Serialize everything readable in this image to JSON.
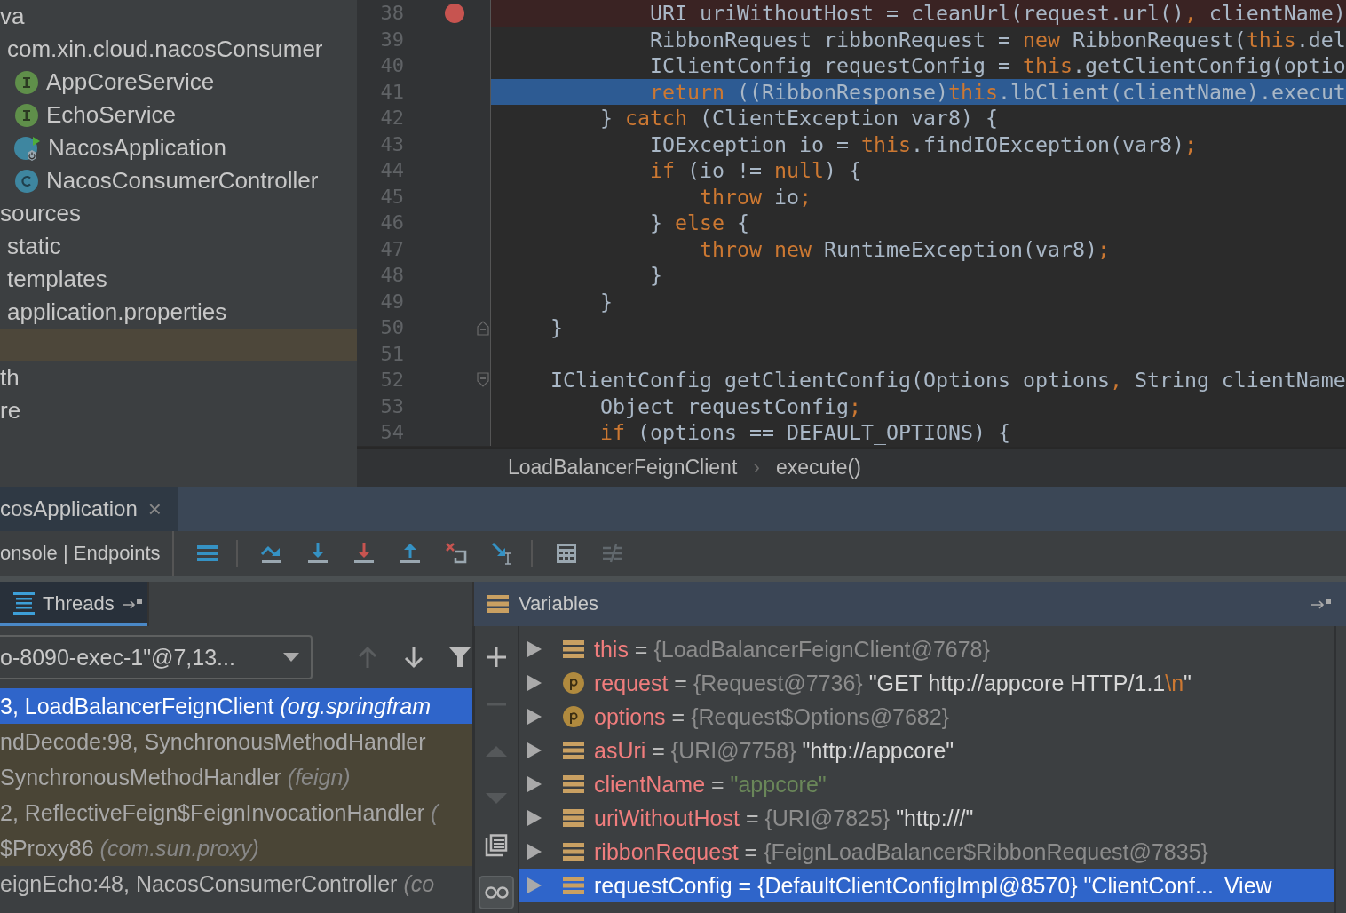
{
  "project_tree": {
    "items": [
      {
        "label": "va",
        "kind": "plain",
        "selected": false,
        "children": [
          {
            "label": "com.xin.cloud.nacosConsumer",
            "kind": "plain",
            "selected": false,
            "children": [
              {
                "label": "AppCoreService",
                "kind": "interface",
                "selected": false
              },
              {
                "label": "EchoService",
                "kind": "interface",
                "selected": false
              },
              {
                "label": "NacosApplication",
                "kind": "spring-app",
                "selected": false
              },
              {
                "label": "NacosConsumerController",
                "kind": "class",
                "selected": false
              }
            ]
          }
        ]
      },
      {
        "label": "sources",
        "kind": "plain",
        "selected": false,
        "children": [
          {
            "label": "static",
            "kind": "plain",
            "selected": false
          },
          {
            "label": "templates",
            "kind": "plain",
            "selected": false
          },
          {
            "label": "application.properties",
            "kind": "plain",
            "selected": false
          }
        ]
      },
      {
        "kind": "blank",
        "selected": true
      },
      {
        "label": "th",
        "kind": "plain",
        "selected": false
      },
      {
        "label": "re",
        "kind": "plain",
        "selected": false
      }
    ]
  },
  "editor": {
    "lines": [
      {
        "number": "38",
        "breakpoint": true,
        "current": false,
        "tokens": [
          {
            "text": "            URI uriWithoutHost = cleanUrl(request.url()",
            "kind": "plain"
          },
          {
            "text": ",",
            "kind": "keyword"
          },
          {
            "text": " clientName)",
            "kind": "plain"
          }
        ]
      },
      {
        "number": "39",
        "breakpoint": false,
        "current": false,
        "tokens": [
          {
            "text": "            RibbonRequest ribbonRequest = ",
            "kind": "plain"
          },
          {
            "text": "new",
            "kind": "keyword"
          },
          {
            "text": " RibbonRequest(",
            "kind": "plain"
          },
          {
            "text": "this",
            "kind": "keyword"
          },
          {
            "text": ".del",
            "kind": "plain"
          }
        ]
      },
      {
        "number": "40",
        "breakpoint": false,
        "current": false,
        "tokens": [
          {
            "text": "            IClientConfig requestConfig = ",
            "kind": "plain"
          },
          {
            "text": "this",
            "kind": "keyword"
          },
          {
            "text": ".getClientConfig(optio",
            "kind": "plain"
          }
        ]
      },
      {
        "number": "41",
        "breakpoint": false,
        "current": true,
        "tokens": [
          {
            "text": "            return",
            "kind": "keyword"
          },
          {
            "text": " ((RibbonResponse)",
            "kind": "plain"
          },
          {
            "text": "this",
            "kind": "keyword"
          },
          {
            "text": ".lbClient(clientName).execut",
            "kind": "plain"
          }
        ]
      },
      {
        "number": "42",
        "breakpoint": false,
        "current": false,
        "tokens": [
          {
            "text": "        } ",
            "kind": "plain"
          },
          {
            "text": "catch",
            "kind": "keyword"
          },
          {
            "text": " (ClientException var8) {",
            "kind": "plain"
          }
        ]
      },
      {
        "number": "43",
        "breakpoint": false,
        "current": false,
        "tokens": [
          {
            "text": "            IOException io = ",
            "kind": "plain"
          },
          {
            "text": "this",
            "kind": "keyword"
          },
          {
            "text": ".findIOException(var8)",
            "kind": "plain"
          },
          {
            "text": ";",
            "kind": "keyword"
          }
        ]
      },
      {
        "number": "44",
        "breakpoint": false,
        "current": false,
        "tokens": [
          {
            "text": "            if",
            "kind": "keyword"
          },
          {
            "text": " (io != ",
            "kind": "plain"
          },
          {
            "text": "null",
            "kind": "keyword"
          },
          {
            "text": ") {",
            "kind": "plain"
          }
        ]
      },
      {
        "number": "45",
        "breakpoint": false,
        "current": false,
        "tokens": [
          {
            "text": "                throw",
            "kind": "keyword"
          },
          {
            "text": " io",
            "kind": "plain"
          },
          {
            "text": ";",
            "kind": "keyword"
          }
        ]
      },
      {
        "number": "46",
        "breakpoint": false,
        "current": false,
        "tokens": [
          {
            "text": "            } ",
            "kind": "plain"
          },
          {
            "text": "else",
            "kind": "keyword"
          },
          {
            "text": " {",
            "kind": "plain"
          }
        ]
      },
      {
        "number": "47",
        "breakpoint": false,
        "current": false,
        "tokens": [
          {
            "text": "                throw new",
            "kind": "keyword"
          },
          {
            "text": " RuntimeException(var8)",
            "kind": "plain"
          },
          {
            "text": ";",
            "kind": "keyword"
          }
        ]
      },
      {
        "number": "48",
        "breakpoint": false,
        "current": false,
        "tokens": [
          {
            "text": "            }",
            "kind": "plain"
          }
        ]
      },
      {
        "number": "49",
        "breakpoint": false,
        "current": false,
        "tokens": [
          {
            "text": "        }",
            "kind": "plain"
          }
        ]
      },
      {
        "number": "50",
        "breakpoint": false,
        "current": false,
        "fold_end": true,
        "tokens": [
          {
            "text": "    }",
            "kind": "plain"
          }
        ]
      },
      {
        "number": "51"
      },
      {
        "number": "52",
        "breakpoint": false,
        "current": false,
        "fold_start": true,
        "tokens": [
          {
            "text": "    IClientConfig getClientConfig(Options options",
            "kind": "plain"
          },
          {
            "text": ",",
            "kind": "keyword"
          },
          {
            "text": " String clientName",
            "kind": "plain"
          }
        ]
      },
      {
        "number": "53",
        "breakpoint": false,
        "current": false,
        "tokens": [
          {
            "text": "        Object requestConfig",
            "kind": "plain"
          },
          {
            "text": ";",
            "kind": "keyword"
          }
        ]
      },
      {
        "number": "54",
        "breakpoint": false,
        "current": false,
        "tokens": [
          {
            "text": "        if",
            "kind": "keyword"
          },
          {
            "text": " (options == DEFAULT_OPTIONS) {",
            "kind": "plain"
          }
        ]
      }
    ],
    "breadcrumbs": [
      "LoadBalancerFeignClient",
      "execute()"
    ],
    "breadcrumb_separator": "›"
  },
  "run_tabs": [
    {
      "label": "cosApplication",
      "selected": true,
      "close": "×"
    }
  ],
  "debug_toolbar": {
    "tabs_label": "onsole | Endpoints",
    "buttons": [
      {
        "kind": "frames-layout",
        "disabled": false
      },
      {
        "kind": "step-over",
        "disabled": false
      },
      {
        "kind": "step-into",
        "disabled": false
      },
      {
        "kind": "force-step-into",
        "disabled": false
      },
      {
        "kind": "step-out",
        "disabled": false
      },
      {
        "kind": "drop-frame",
        "disabled": false
      },
      {
        "kind": "run-to-cursor",
        "disabled": false
      },
      {
        "kind": "evaluate",
        "disabled": false
      },
      {
        "kind": "trace",
        "disabled": true
      }
    ]
  },
  "threads_panel": {
    "title": "Threads",
    "selected": true,
    "thread_selector": "o-8090-exec-1\"@7,13...",
    "nav_buttons": [
      {
        "kind": "up",
        "disabled": true
      },
      {
        "kind": "down",
        "disabled": false
      },
      {
        "kind": "filter",
        "disabled": false
      }
    ],
    "frames": [
      {
        "frame": "3, LoadBalancerFeignClient",
        "package": "(org.springfram",
        "library": false,
        "selected": true
      },
      {
        "frame": "ndDecode:98, SynchronousMethodHandler",
        "library": true,
        "selected": false
      },
      {
        "frame": "SynchronousMethodHandler",
        "package": "(feign)",
        "library": true,
        "selected": false
      },
      {
        "frame": "2, ReflectiveFeign$FeignInvocationHandler",
        "package": "(",
        "library": true,
        "selected": false
      },
      {
        "frame": "$Proxy86",
        "package": "(com.sun.proxy)",
        "library": true,
        "selected": false
      },
      {
        "frame": "eignEcho:48, NacosConsumerController",
        "package": "(co",
        "library": false,
        "selected": false
      }
    ]
  },
  "side_toolbar": [
    {
      "kind": "add",
      "disabled": false,
      "on": false
    },
    {
      "kind": "remove",
      "disabled": true,
      "on": false
    },
    {
      "kind": "up",
      "disabled": true,
      "on": false
    },
    {
      "kind": "down",
      "disabled": true,
      "on": false
    },
    {
      "kind": "copy",
      "disabled": false,
      "on": false
    },
    {
      "kind": "watches",
      "disabled": false,
      "on": true
    }
  ],
  "variables_panel": {
    "title": "Variables",
    "variables": [
      {
        "kind": "field",
        "name": "this",
        "operator": "=",
        "type": "{LoadBalancerFeignClient@7678}",
        "selected": false
      },
      {
        "kind": "parameter",
        "name": "request",
        "operator": "=",
        "type": "{Request@7736}",
        "value": [
          {
            "text": "\"GET http://appcore HTTP/1.1",
            "kind": "string"
          },
          {
            "text": "\\n",
            "kind": "escape"
          },
          {
            "text": "\"",
            "kind": "string"
          }
        ],
        "selected": false
      },
      {
        "kind": "parameter",
        "name": "options",
        "operator": "=",
        "type": "{Request$Options@7682}",
        "selected": false
      },
      {
        "kind": "field",
        "name": "asUri",
        "operator": "=",
        "type": "{URI@7758}",
        "value": [
          {
            "text": "\"http://appcore\"",
            "kind": "string"
          }
        ],
        "selected": false
      },
      {
        "kind": "field",
        "name": "clientName",
        "operator": "=",
        "value": [
          {
            "text": "\"appcore\"",
            "kind": "literal"
          }
        ],
        "selected": false
      },
      {
        "kind": "field",
        "name": "uriWithoutHost",
        "operator": "=",
        "type": "{URI@7825}",
        "value": [
          {
            "text": "\"http:///\"",
            "kind": "string"
          }
        ],
        "selected": false
      },
      {
        "kind": "field",
        "name": "ribbonRequest",
        "operator": "=",
        "type": "{FeignLoadBalancer$RibbonRequest@7835}",
        "selected": false
      },
      {
        "kind": "field",
        "name": "requestConfig",
        "operator": "=",
        "type": "{DefaultClientConfigImpl@8570}",
        "value": [
          {
            "text": "\"ClientConf...",
            "kind": "string"
          }
        ],
        "link": "View",
        "selected": true
      }
    ]
  }
}
